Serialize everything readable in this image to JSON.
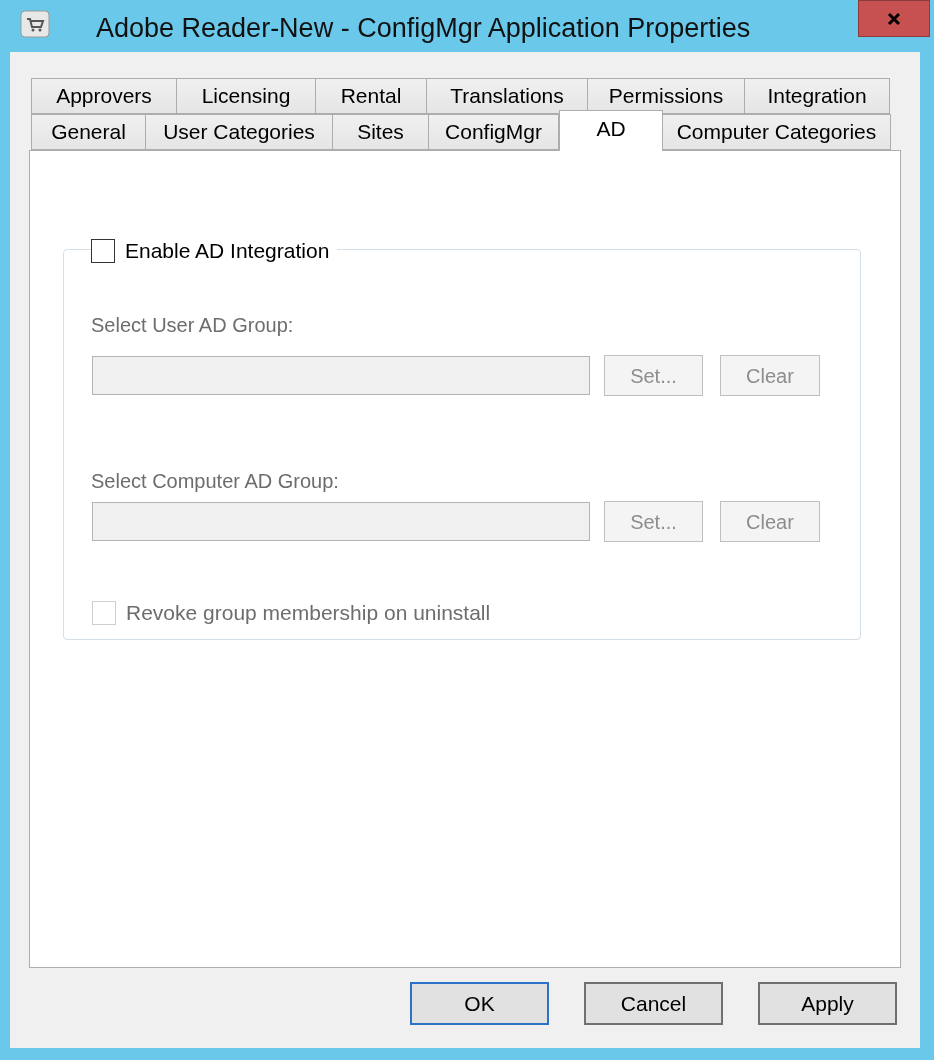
{
  "window": {
    "title": "Adobe Reader-New - ConfigMgr Application Properties"
  },
  "tab_rows": [
    [
      {
        "label": "Approvers",
        "selected": false
      },
      {
        "label": "Licensing",
        "selected": false
      },
      {
        "label": "Rental",
        "selected": false
      },
      {
        "label": "Translations",
        "selected": false
      },
      {
        "label": "Permissions",
        "selected": false
      },
      {
        "label": "Integration",
        "selected": false
      }
    ],
    [
      {
        "label": "General",
        "selected": false
      },
      {
        "label": "User Categories",
        "selected": false
      },
      {
        "label": "Sites",
        "selected": false
      },
      {
        "label": "ConfigMgr",
        "selected": false
      },
      {
        "label": "AD",
        "selected": true
      },
      {
        "label": "Computer Categories",
        "selected": false
      }
    ]
  ],
  "group": {
    "checkbox": {
      "label": "Enable AD Integration",
      "checked": false
    },
    "pickers": [
      {
        "label": "Select User AD Group:",
        "disabled": true,
        "buttons": [
          "Set...",
          "Clear"
        ]
      },
      {
        "label": "Select Computer AD Group:",
        "disabled": true,
        "buttons": [
          "Set...",
          "Clear"
        ]
      }
    ],
    "revoke": {
      "label": "Revoke group membership on uninstall",
      "checked": false,
      "disabled": true
    }
  },
  "buttons": [
    {
      "label": "OK",
      "default": true
    },
    {
      "label": "Cancel",
      "default": false
    },
    {
      "label": "Apply",
      "default": false
    }
  ]
}
